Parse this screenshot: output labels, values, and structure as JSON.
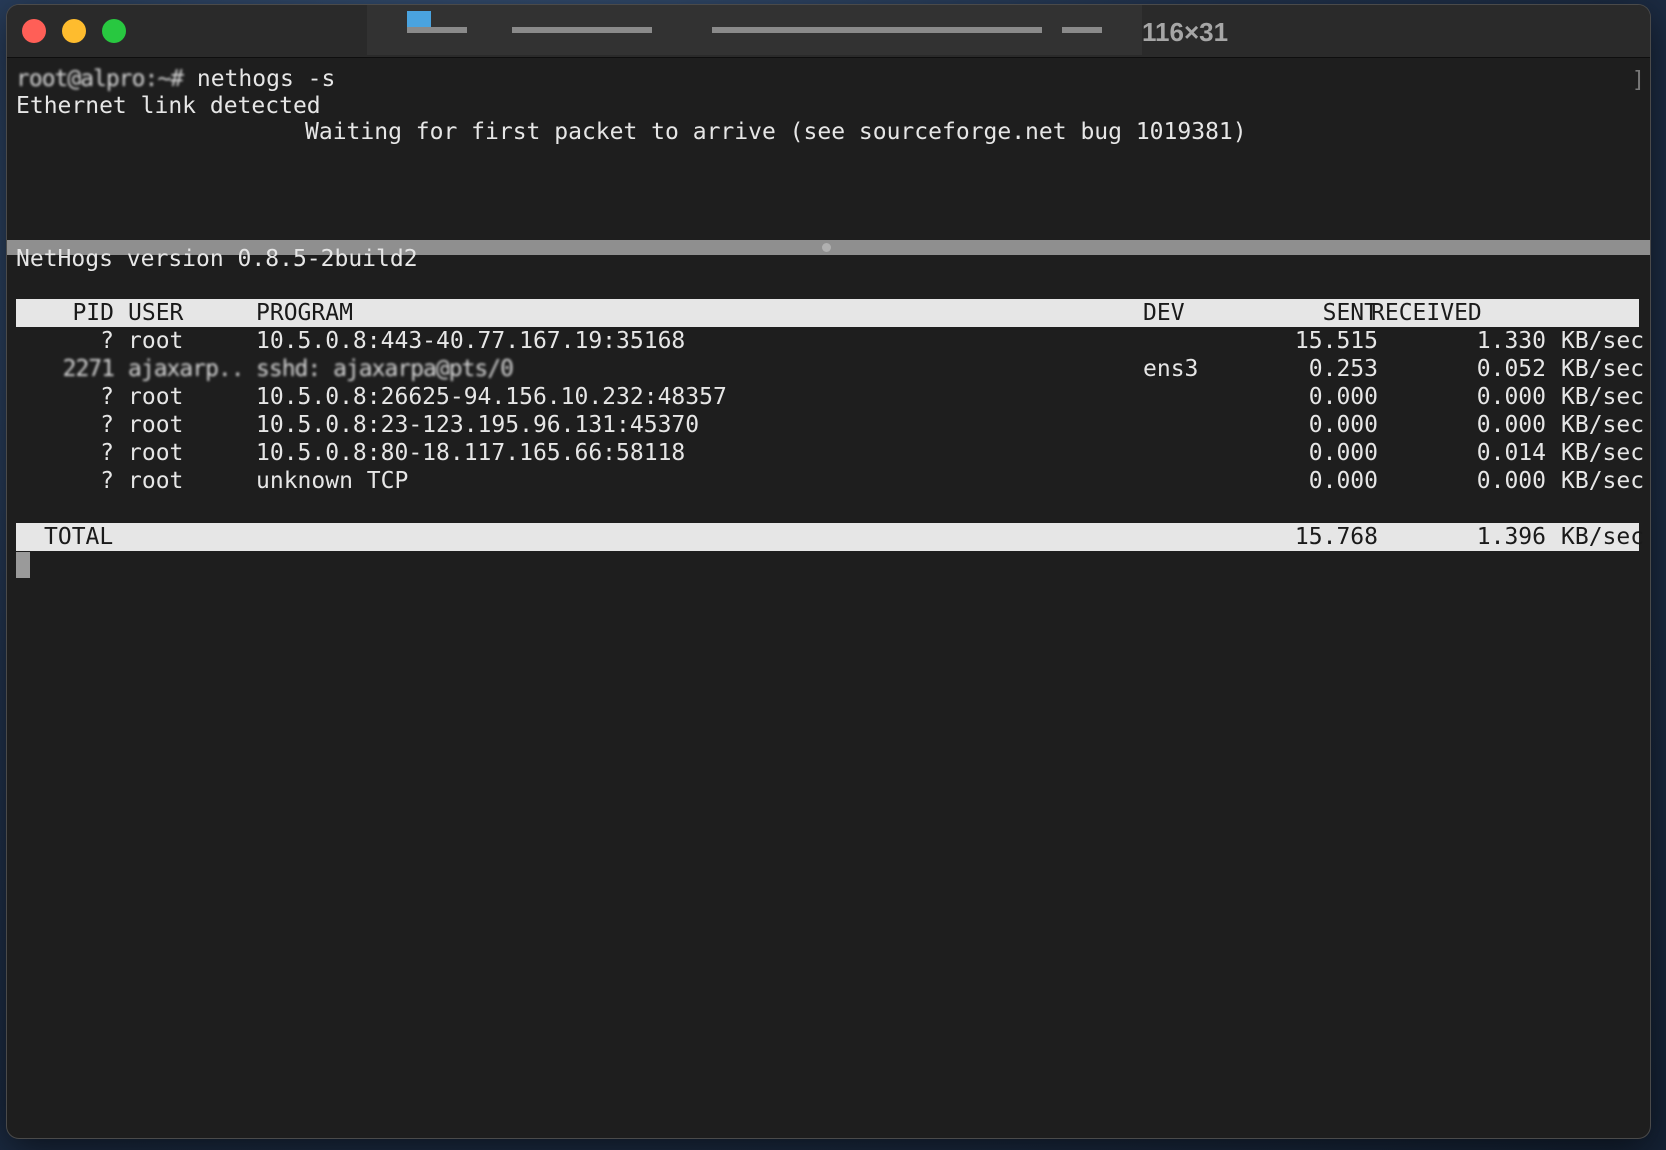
{
  "window": {
    "title_suffix": "116×31"
  },
  "top_pane": {
    "prompt_user": "root@alpro:~#",
    "command": " nethogs -s",
    "line1": "Ethernet link detected",
    "line2": "Waiting for first packet to arrive (see sourceforge.net bug 1019381)"
  },
  "bottom_pane": {
    "version": "NetHogs version 0.8.5-2build2",
    "headers": {
      "pid": "PID",
      "user": "USER",
      "program": "PROGRAM",
      "dev": "DEV",
      "sent": "SENT",
      "received": "RECEIVED"
    },
    "rows": [
      {
        "pid": "?",
        "user": "root",
        "program": "10.5.0.8:443-40.77.167.19:35168",
        "dev": "",
        "sent": "15.515",
        "received": "1.330",
        "unit": "KB/sec"
      },
      {
        "pid": "2271",
        "user": "ajaxarp..",
        "program": "sshd: ajaxarpa@pts/0",
        "dev": "ens3",
        "sent": "0.253",
        "received": "0.052",
        "unit": "KB/sec"
      },
      {
        "pid": "?",
        "user": "root",
        "program": "10.5.0.8:26625-94.156.10.232:48357",
        "dev": "",
        "sent": "0.000",
        "received": "0.000",
        "unit": "KB/sec"
      },
      {
        "pid": "?",
        "user": "root",
        "program": "10.5.0.8:23-123.195.96.131:45370",
        "dev": "",
        "sent": "0.000",
        "received": "0.000",
        "unit": "KB/sec"
      },
      {
        "pid": "?",
        "user": "root",
        "program": "10.5.0.8:80-18.117.165.66:58118",
        "dev": "",
        "sent": "0.000",
        "received": "0.014",
        "unit": "KB/sec"
      },
      {
        "pid": "?",
        "user": "root",
        "program": "unknown TCP",
        "dev": "",
        "sent": "0.000",
        "received": "0.000",
        "unit": "KB/sec"
      }
    ],
    "total": {
      "label": "TOTAL",
      "sent": "15.768",
      "received": "1.396",
      "unit": "KB/sec"
    }
  }
}
